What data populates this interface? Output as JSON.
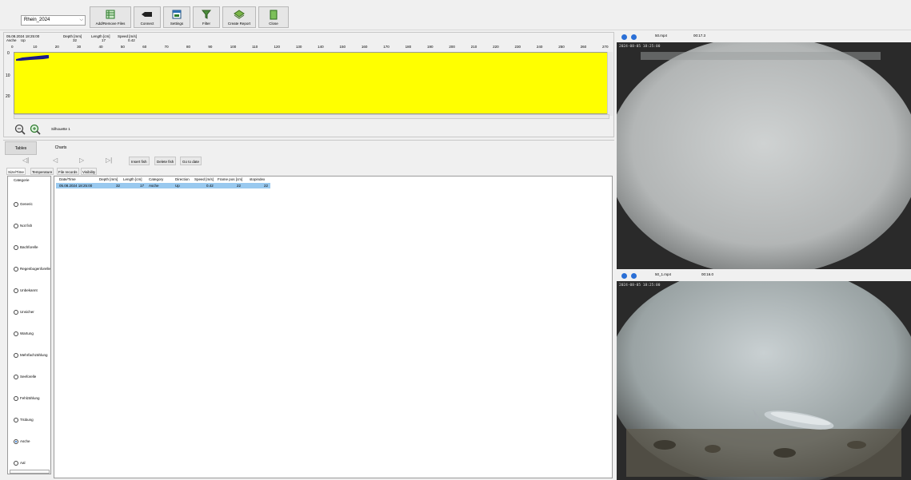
{
  "toolbar": {
    "project": "Rhein_2024",
    "buttons": [
      "Add/Remove Files",
      "Connect",
      "Settings",
      "Filter",
      "Create Report",
      "Close"
    ]
  },
  "silhouette": {
    "datetime": "05.08.2024 18:25:00",
    "species": "Asche",
    "direction": "Up",
    "depth_label": "Depth [mm]",
    "depth_value": "32",
    "length_label": "Length [cm]",
    "length_value": "17",
    "speed_label": "Speed [m/s]",
    "speed_value": "0.42",
    "ruler_ticks": [
      "0",
      "10",
      "20",
      "30",
      "40",
      "50",
      "60",
      "70",
      "80",
      "90",
      "100",
      "110",
      "120",
      "130",
      "140",
      "150",
      "160",
      "170",
      "180",
      "190",
      "200",
      "210",
      "220",
      "230",
      "240",
      "250",
      "260",
      "270"
    ],
    "y_ticks": [
      "0",
      "10",
      "20"
    ],
    "caption": "Silhouette 1"
  },
  "tabs": [
    "Tables",
    "Charts"
  ],
  "actions": [
    "Insert fish",
    "Delete fish",
    "Go to date"
  ],
  "subtabs": [
    "Size/Time",
    "Temperature",
    "File records",
    "Visibility"
  ],
  "categories": {
    "title": "Categorie",
    "items": [
      "Generic",
      "Not fish",
      "Bachforelle",
      "Regenbogenforelle",
      "Unbekannt",
      "Unsicher",
      "Wartung",
      "Mehrfachzählung",
      "Seeforelle",
      "Fehlzählung",
      "Trübung",
      "Asche",
      "Aal"
    ],
    "selected": "Asche"
  },
  "table": {
    "columns": [
      "Date/Time",
      "Depth [mm]",
      "Length [cm]",
      "Category",
      "Direction",
      "Speed [m/s]",
      "Frame pos [cm]",
      "stopindex"
    ],
    "rows": [
      [
        "05.08.2024 18:25:00",
        "32",
        "17",
        "Asche",
        "Up",
        "0.42",
        "22",
        "22"
      ]
    ]
  },
  "videos": [
    {
      "file": "50.mp4",
      "time": "00:17.3",
      "stamp": "2024-08-05 18:25:00"
    },
    {
      "file": "50_1.mp4",
      "time": "00:16.0",
      "stamp": "2024-08-05 18:25:00"
    }
  ],
  "colors": {
    "plot_bg": "#ffff00",
    "silhouette": "#1a1a8c",
    "selection": "#99c9ef",
    "accent": "#2a6fd6"
  }
}
